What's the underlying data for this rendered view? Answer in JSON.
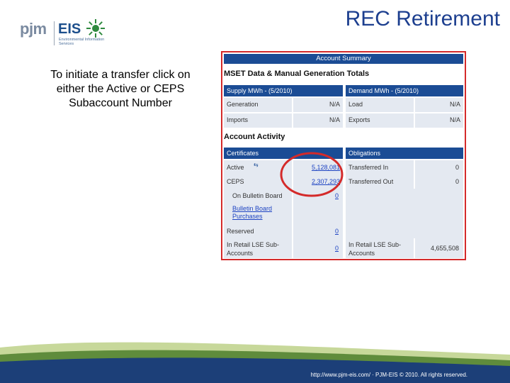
{
  "logo": {
    "pjm": "pjm",
    "eis": "EIS",
    "subtitle": "Environmental Information Services"
  },
  "slide_title": "REC Retirement",
  "instructions": "To initiate a transfer click on either the Active or CEPS Subaccount Number",
  "panel": {
    "summary_header": "Account Summary",
    "mset_title": "MSET Data & Manual Generation Totals",
    "supply_header": "Supply MWh - (5/2010)",
    "demand_header": "Demand MWh - (5/2010)",
    "supply_rows": [
      {
        "label": "Generation",
        "value": "N/A"
      },
      {
        "label": "Imports",
        "value": "N/A"
      }
    ],
    "demand_rows": [
      {
        "label": "Load",
        "value": "N/A"
      },
      {
        "label": "Exports",
        "value": "N/A"
      }
    ],
    "activity_title": "Account Activity",
    "certificates_header": "Certificates",
    "obligations_header": "Obligations",
    "active_label": "Active",
    "active_value": "5,128,081",
    "ceps_label": "CEPS",
    "ceps_value": "2,307,293",
    "bulletin_label": "On Bulletin Board",
    "bulletin_value": "0",
    "bulletin_purchases": "Bulletin Board Purchases",
    "reserved_label": "Reserved",
    "reserved_value": "0",
    "retail_label": "In Retail LSE Sub-Accounts",
    "retail_value": "0",
    "transferred_in_label": "Transferred In",
    "transferred_in_value": "0",
    "transferred_out_label": "Transferred Out",
    "transferred_out_value": "0",
    "in_retail_label": "In Retail LSE Sub-Accounts",
    "in_retail_value": "4,655,508"
  },
  "footer": "http://www.pjm-eis.com/ · PJM-EIS © 2010. All rights reserved.",
  "colors": {
    "title": "#1d3f8f",
    "panel_header": "#1b4c95",
    "cell_bg": "#e4e9f1",
    "highlight": "#d42a2a",
    "link": "#1d43c2"
  }
}
